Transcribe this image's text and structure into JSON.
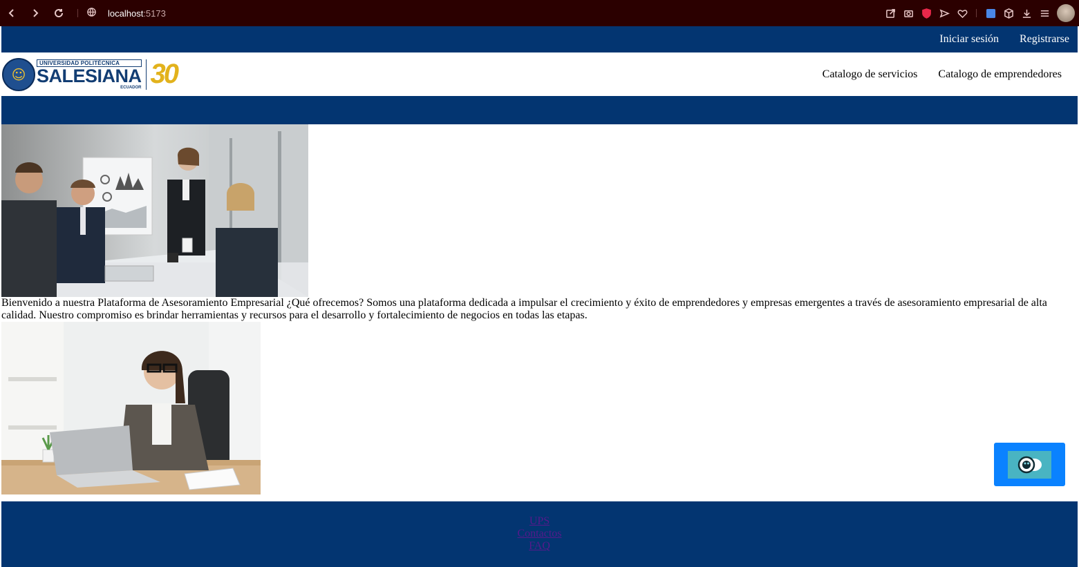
{
  "browser": {
    "url_host": "localhost",
    "url_port": ":5173"
  },
  "topbar": {
    "login_label": "Iniciar sesión",
    "register_label": "Registrarse"
  },
  "header": {
    "logo": {
      "line1": "UNIVERSIDAD POLITÉCNICA",
      "line2": "SALESIANA",
      "line3": "ECUADOR",
      "anniversary": "30"
    },
    "nav": {
      "services_label": "Catalogo de servicios",
      "entrepreneurs_label": "Catalogo de emprendedores"
    }
  },
  "main": {
    "intro_text": "Bienvenido a nuestra Plataforma de Asesoramiento Empresarial ¿Qué ofrecemos? Somos una plataforma dedicada a impulsar el crecimiento y éxito de emprendedores y empresas emergentes a través de asesoramiento empresarial de alta calidad. Nuestro compromiso es brindar herramientas y recursos para el desarrollo y fortalecimiento de negocios en todas las etapas."
  },
  "footer": {
    "links": [
      "UPS",
      "Contactos",
      "FAQ"
    ]
  },
  "colors": {
    "brand_blue": "#033571",
    "chrome_bg": "#2b0000",
    "chat_button": "#0a82ff",
    "logo_gold": "#e2b21c"
  }
}
